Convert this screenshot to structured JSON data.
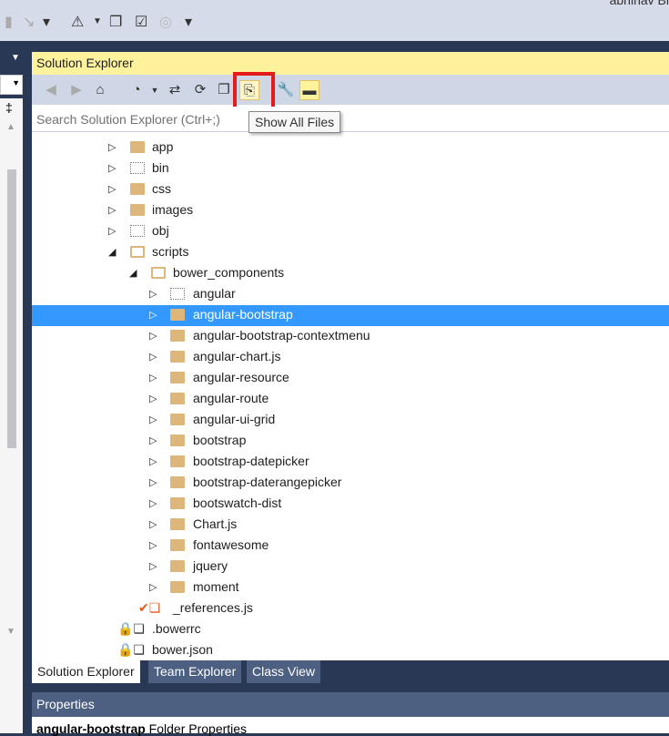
{
  "topbar": {
    "user": "abhinav Bi"
  },
  "solution_explorer": {
    "title": "Solution Explorer",
    "search_placeholder": "Search Solution Explorer (Ctrl+;)",
    "tooltip": "Show All Files",
    "tree": [
      {
        "label": "app",
        "level": 1,
        "icon": "folder",
        "expanded": false
      },
      {
        "label": "bin",
        "level": 1,
        "icon": "folder-hidden",
        "expanded": false
      },
      {
        "label": "css",
        "level": 1,
        "icon": "folder",
        "expanded": false
      },
      {
        "label": "images",
        "level": 1,
        "icon": "folder",
        "expanded": false
      },
      {
        "label": "obj",
        "level": 1,
        "icon": "folder-hidden",
        "expanded": false
      },
      {
        "label": "scripts",
        "level": 1,
        "icon": "folder-open",
        "expanded": true
      },
      {
        "label": "bower_components",
        "level": 2,
        "icon": "folder-open",
        "expanded": true
      },
      {
        "label": "angular",
        "level": 3,
        "icon": "folder-hidden",
        "expanded": false
      },
      {
        "label": "angular-bootstrap",
        "level": 3,
        "icon": "folder",
        "expanded": false,
        "selected": true
      },
      {
        "label": "angular-bootstrap-contextmenu",
        "level": 3,
        "icon": "folder",
        "expanded": false
      },
      {
        "label": "angular-chart.js",
        "level": 3,
        "icon": "folder",
        "expanded": false
      },
      {
        "label": "angular-resource",
        "level": 3,
        "icon": "folder",
        "expanded": false
      },
      {
        "label": "angular-route",
        "level": 3,
        "icon": "folder",
        "expanded": false
      },
      {
        "label": "angular-ui-grid",
        "level": 3,
        "icon": "folder",
        "expanded": false
      },
      {
        "label": "bootstrap",
        "level": 3,
        "icon": "folder",
        "expanded": false
      },
      {
        "label": "bootstrap-datepicker",
        "level": 3,
        "icon": "folder",
        "expanded": false
      },
      {
        "label": "bootstrap-daterangepicker",
        "level": 3,
        "icon": "folder",
        "expanded": false
      },
      {
        "label": "bootswatch-dist",
        "level": 3,
        "icon": "folder",
        "expanded": false
      },
      {
        "label": "Chart.js",
        "level": 3,
        "icon": "folder",
        "expanded": false
      },
      {
        "label": "fontawesome",
        "level": 3,
        "icon": "folder",
        "expanded": false
      },
      {
        "label": "jquery",
        "level": 3,
        "icon": "folder",
        "expanded": false
      },
      {
        "label": "moment",
        "level": 3,
        "icon": "folder",
        "expanded": false
      },
      {
        "label": "_references.js",
        "level": 2,
        "icon": "js-file-checked"
      },
      {
        "label": ".bowerrc",
        "level": 1,
        "icon": "file-locked"
      },
      {
        "label": "bower.json",
        "level": 1,
        "icon": "json-file-locked"
      }
    ]
  },
  "tabs": [
    "Solution Explorer",
    "Team Explorer",
    "Class View"
  ],
  "properties": {
    "title": "Properties",
    "object_name": "angular-bootstrap",
    "object_type": "Folder Properties"
  },
  "colors": {
    "title_bar": "#fff29d",
    "selection": "#3399ff",
    "frame": "#293955",
    "highlight_box": "#e51a1a"
  }
}
